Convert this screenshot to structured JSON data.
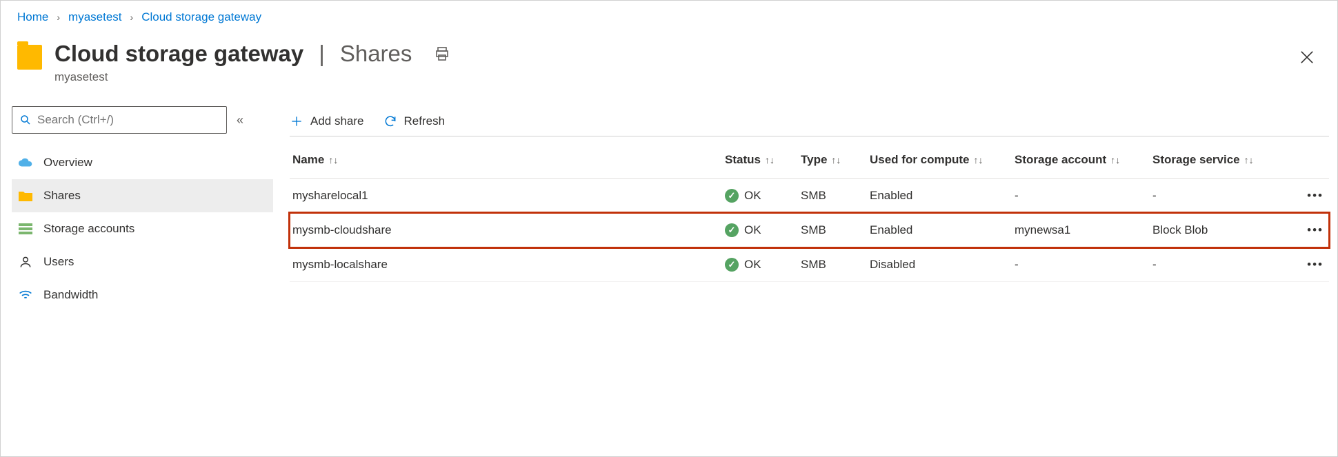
{
  "breadcrumb": {
    "home": "Home",
    "resource": "myasetest",
    "page": "Cloud storage gateway"
  },
  "header": {
    "title": "Cloud storage gateway",
    "section": "Shares",
    "subtitle": "myasetest"
  },
  "search": {
    "placeholder": "Search (Ctrl+/)"
  },
  "sidebar": {
    "items": [
      {
        "label": "Overview"
      },
      {
        "label": "Shares"
      },
      {
        "label": "Storage accounts"
      },
      {
        "label": "Users"
      },
      {
        "label": "Bandwidth"
      }
    ]
  },
  "toolbar": {
    "add_share": "Add share",
    "refresh": "Refresh"
  },
  "columns": {
    "name": "Name",
    "status": "Status",
    "type": "Type",
    "compute": "Used for compute",
    "account": "Storage account",
    "service": "Storage service"
  },
  "status_ok": "OK",
  "rows": [
    {
      "name": "mysharelocal1",
      "type": "SMB",
      "compute": "Enabled",
      "account": "-",
      "service": "-"
    },
    {
      "name": "mysmb-cloudshare",
      "type": "SMB",
      "compute": "Enabled",
      "account": "mynewsa1",
      "service": "Block Blob"
    },
    {
      "name": "mysmb-localshare",
      "type": "SMB",
      "compute": "Disabled",
      "account": "-",
      "service": "-"
    }
  ]
}
